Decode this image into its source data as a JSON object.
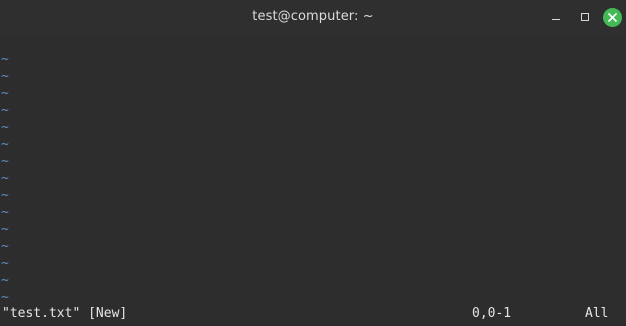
{
  "window": {
    "title": "test@computer: ~"
  },
  "editor": {
    "empty_line_marker": "~",
    "empty_line_count": 15,
    "status_file": "\"test.txt\" [New]",
    "cursor_position": "0,0-1",
    "scroll_indicator": "All"
  },
  "colors": {
    "background": "#2d2d2d",
    "text": "#e6e6e6",
    "tilde": "#5c8fc3",
    "close_button": "#44b956"
  },
  "icons": {
    "minimize": "minimize-icon",
    "maximize": "maximize-icon",
    "close": "close-icon"
  }
}
